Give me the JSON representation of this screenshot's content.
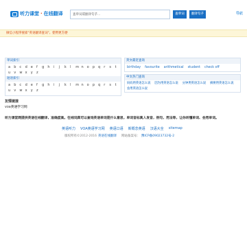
{
  "header": {
    "logo_text": "听力课堂",
    "logo_sep": "·",
    "logo_sub": "在线翻译",
    "search_placeholder": "查单词或翻译句子...",
    "btn_word": "查单词",
    "btn_sentence": "翻译句子",
    "nav_link": "导航"
  },
  "notice": "微信小程序搜索\"英语翻译查词\"，使用更方便",
  "left_panel": {
    "word_index_title": "单词索引",
    "phrase_index_title": "短语索引",
    "letters": [
      "a",
      "b",
      "c",
      "d",
      "e",
      "f",
      "g",
      "h",
      "i",
      "j",
      "k",
      "l",
      "m",
      "n",
      "o",
      "p",
      "q",
      "r",
      "s",
      "t",
      "u",
      "v",
      "w",
      "x",
      "y",
      "z"
    ]
  },
  "right_panel": {
    "hot_title": "英文最近查询",
    "hot_words": [
      "birthday",
      "favourite",
      "arithmetical",
      "student",
      "check off"
    ],
    "cn_title": "中文热门查询",
    "cn_queries": [
      "妈妈用英语怎么说",
      "因为用英语怎么说",
      "分钟用英语怎么说",
      "摘要用英语怎么说",
      "会用英语怎么说"
    ]
  },
  "friend_links": {
    "title": "友情链接",
    "items": [
      "voa英语学习网"
    ]
  },
  "intro": "听力课堂网提供英语在线翻译，准确度高。在线词典可以查询英语单词是什么意思，单词音标真人发音，例句，用法等，让你听懂单词、会用单词。",
  "footer": {
    "links": [
      "英语听力",
      "VOA英语学习网",
      "英语口语",
      "新概念英语",
      "汉语大全",
      "sitemap"
    ],
    "copy_prefix": "版权所有©2012-2016",
    "copy_site": "英语在线翻译",
    "copy_mid": "网站备案号：",
    "copy_icp": "豫ICP备09023732号-2"
  }
}
